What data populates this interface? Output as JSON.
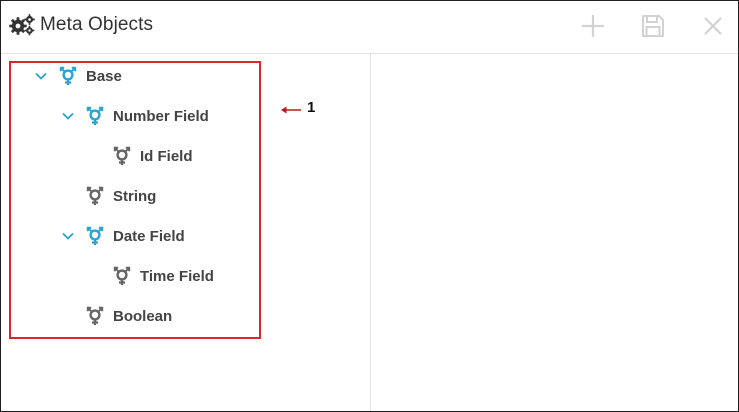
{
  "window": {
    "title": "Meta Objects",
    "title_icon": "gears-icon",
    "toolbar": {
      "add_icon": "plus-icon",
      "save_icon": "floppy-disk-icon",
      "close_icon": "close-icon"
    }
  },
  "tree": {
    "nodes": [
      {
        "label": "Base",
        "expanded": true,
        "icon": "node-icon"
      },
      {
        "label": "Number Field",
        "expanded": true,
        "icon": "node-icon"
      },
      {
        "label": "Id Field",
        "expanded": false,
        "icon": "node-icon"
      },
      {
        "label": "String",
        "expanded": false,
        "icon": "node-icon"
      },
      {
        "label": "Date Field",
        "expanded": true,
        "icon": "node-icon"
      },
      {
        "label": "Time Field",
        "expanded": false,
        "icon": "node-icon"
      },
      {
        "label": "Boolean",
        "expanded": false,
        "icon": "node-icon"
      }
    ]
  },
  "annotation": {
    "number": "1"
  },
  "colors": {
    "accent": "#2aa3d6",
    "leaf": "#666666",
    "highlight": "#d9282a",
    "arrow": "#c0181a",
    "toolbar_disabled": "#d2d2d2"
  }
}
